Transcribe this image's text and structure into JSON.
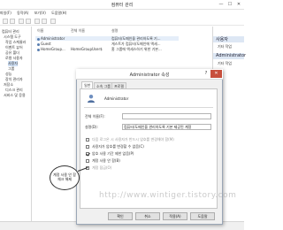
{
  "window": {
    "title": "컴퓨터 관리",
    "minimize": "—",
    "maximize": "☐",
    "close": "✕"
  },
  "menu": [
    "파일(F)",
    "동작(A)",
    "보기(V)",
    "도움말(H)"
  ],
  "tree": {
    "items": [
      "컴퓨터 관리",
      "시스템 도구",
      "작업 스케줄러",
      "이벤트 뷰어",
      "공유 폴더",
      "로컬 사용자",
      "사용자",
      "그룹",
      "성능",
      "장치 관리자",
      "저장소",
      "디스크 관리",
      "서비스 및 응용"
    ]
  },
  "list": {
    "headers": [
      "이름",
      "전체 이름",
      "설명"
    ],
    "rows": [
      {
        "name": "Administrator",
        "desc": "컴퓨터/도메인을 관리하도록 기..."
      },
      {
        "name": "Guest",
        "desc": "게스트가 컴퓨터/도메인에 액세..."
      },
      {
        "name": "HomeGroup...",
        "full": "HomeGroupUser$",
        "desc": "홈 그룹에 액세스하기 위한 기본..."
      }
    ]
  },
  "actions": {
    "header1": "사용자",
    "item1": "기타 작업",
    "header2": "Administrator",
    "item2": "기타 작업"
  },
  "dialog": {
    "title": "Administrator 속성",
    "help": "?",
    "close": "✕",
    "tabs": [
      "일반",
      "소속 그룹",
      "프로필"
    ],
    "username": "Administrator",
    "fields": {
      "fullname_label": "전체 이름(F):",
      "fullname_value": "",
      "desc_label": "설명(D):",
      "desc_value": "컴퓨터/도메인을 관리하도록 기본 제공된 계정"
    },
    "checkboxes": [
      {
        "label": "다음 로그온 시 사용자가 반드시 암호를 변경해야 함(M)",
        "checked": false,
        "enabled": false
      },
      {
        "label": "사용자가 암호를 변경할 수 없음(C)",
        "checked": false,
        "enabled": true
      },
      {
        "label": "암호 사용 기간 제한 없음(P)",
        "checked": true,
        "enabled": true
      },
      {
        "label": "계정 사용 안 함(B)",
        "checked": false,
        "enabled": true
      },
      {
        "label": "계정 잠금(O)",
        "checked": false,
        "enabled": false
      }
    ],
    "buttons": [
      "확인",
      "취소",
      "적용(A)",
      "도움말"
    ]
  },
  "annotation": {
    "text": "계정 사용 안 함\n체크 해제"
  },
  "watermark": "http://www.wintiger.tistory.com"
}
